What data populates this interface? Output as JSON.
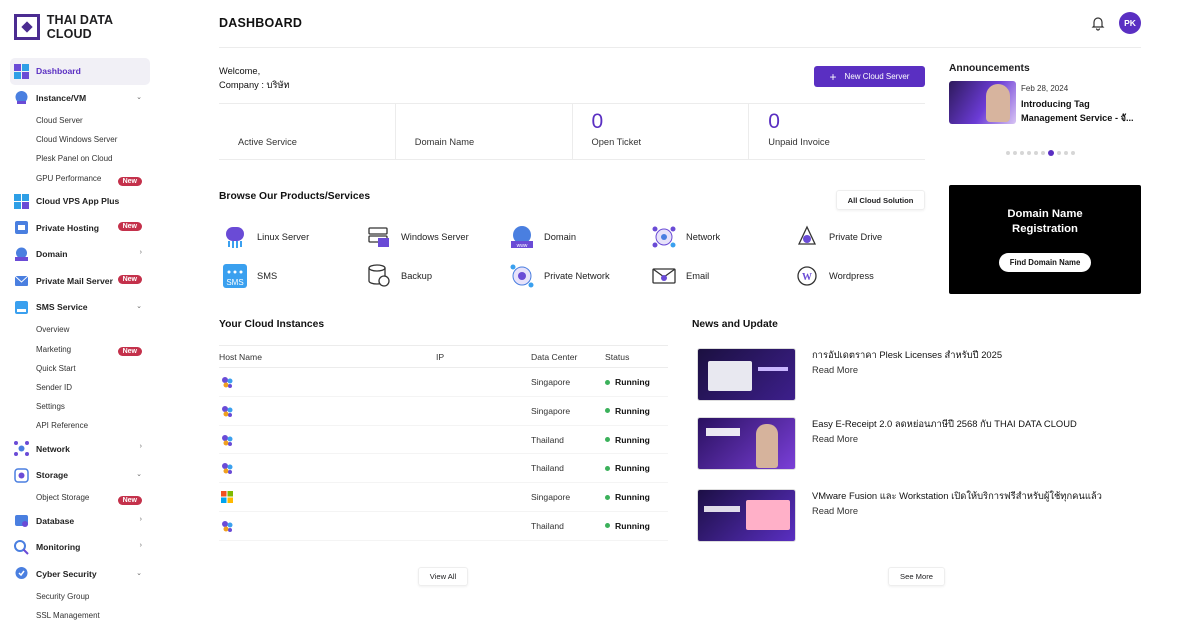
{
  "brand": {
    "name": "THAI DATA CLOUD"
  },
  "sidebar": {
    "items": [
      {
        "label": "Dashboard",
        "active": true,
        "chevron": "",
        "badge": ""
      },
      {
        "label": "Instance/VM",
        "chevron": "⌄",
        "badge": ""
      },
      {
        "label": "Cloud VPS App Plus",
        "chevron": "",
        "badge": ""
      },
      {
        "label": "Private Hosting",
        "chevron": "",
        "badge": "New"
      },
      {
        "label": "Domain",
        "chevron": "›",
        "badge": ""
      },
      {
        "label": "Private Mail Server",
        "chevron": "",
        "badge": "New"
      },
      {
        "label": "SMS Service",
        "chevron": "⌄",
        "badge": ""
      },
      {
        "label": "Network",
        "chevron": "›",
        "badge": ""
      },
      {
        "label": "Storage",
        "chevron": "⌄",
        "badge": ""
      },
      {
        "label": "Database",
        "chevron": "›",
        "badge": ""
      },
      {
        "label": "Monitoring",
        "chevron": "›",
        "badge": ""
      },
      {
        "label": "Cyber Security",
        "chevron": "⌄",
        "badge": ""
      }
    ],
    "instance_sub": [
      "Cloud Server",
      "Cloud Windows Server",
      "Plesk Panel on Cloud",
      "GPU Performance"
    ],
    "gpu_badge": "New",
    "sms_sub": [
      "Overview",
      "Marketing",
      "Quick Start",
      "Sender ID",
      "Settings",
      "API Reference"
    ],
    "marketing_badge": "New",
    "storage_sub": [
      "Object Storage"
    ],
    "object_storage_badge": "New",
    "security_sub": [
      "Security Group",
      "SSL Management"
    ]
  },
  "header": {
    "title": "DASHBOARD",
    "avatar_initials": "PK",
    "bell_icon": "bell-icon"
  },
  "welcome": {
    "greeting": "Welcome,",
    "company": "Company : บริษัท",
    "new_server_label": "New Cloud Server"
  },
  "stats": [
    {
      "value": "",
      "label": "Active Service"
    },
    {
      "value": "",
      "label": "Domain Name"
    },
    {
      "value": "0",
      "label": "Open Ticket"
    },
    {
      "value": "0",
      "label": "Unpaid Invoice"
    }
  ],
  "products": {
    "title": "Browse Our Products/Services",
    "all_button": "All Cloud Solution",
    "items": [
      {
        "label": "Linux Server",
        "icon": "linux-server-icon"
      },
      {
        "label": "Windows Server",
        "icon": "windows-server-icon"
      },
      {
        "label": "Domain",
        "icon": "domain-icon"
      },
      {
        "label": "Network",
        "icon": "network-icon"
      },
      {
        "label": "Private Drive",
        "icon": "private-drive-icon"
      },
      {
        "label": "SMS",
        "icon": "sms-icon"
      },
      {
        "label": "Backup",
        "icon": "backup-icon"
      },
      {
        "label": "Private Network",
        "icon": "private-network-icon"
      },
      {
        "label": "Email",
        "icon": "email-icon"
      },
      {
        "label": "Wordpress",
        "icon": "wordpress-icon"
      }
    ]
  },
  "announcements": {
    "title": "Announcements",
    "date": "Feb 28, 2024",
    "text": "Introducing Tag Management Service - จั...",
    "slide_count": 10,
    "active_slide": 6
  },
  "domain_card": {
    "title_line1": "Domain Name",
    "title_line2": "Registration",
    "button": "Find Domain Name"
  },
  "instances": {
    "title": "Your Cloud Instances",
    "columns": [
      "Host Name",
      "IP",
      "Data Center",
      "Status"
    ],
    "rows": [
      {
        "host": "",
        "ip": "",
        "dc": "Singapore",
        "status": "Running",
        "os_icon": "linux-os-icon"
      },
      {
        "host": "",
        "ip": "",
        "dc": "Singapore",
        "status": "Running",
        "os_icon": "linux-os-icon"
      },
      {
        "host": "",
        "ip": "",
        "dc": "Thailand",
        "status": "Running",
        "os_icon": "linux-os-icon"
      },
      {
        "host": "",
        "ip": "",
        "dc": "Thailand",
        "status": "Running",
        "os_icon": "linux-os-icon"
      },
      {
        "host": "",
        "ip": "",
        "dc": "Singapore",
        "status": "Running",
        "os_icon": "windows-os-icon"
      },
      {
        "host": "",
        "ip": "",
        "dc": "Thailand",
        "status": "Running",
        "os_icon": "linux-os-icon"
      }
    ],
    "view_all": "View All"
  },
  "news": {
    "title": "News and Update",
    "items": [
      {
        "title": "การอัปเดตราคา Plesk Licenses สำหรับปี 2025",
        "more": "Read More"
      },
      {
        "title": "Easy E-Receipt 2.0 ลดหย่อนภาษีปี 2568 กับ THAI DATA CLOUD",
        "more": "Read More"
      },
      {
        "title": "VMware Fusion และ Workstation เปิดให้บริการฟรีสำหรับผู้ใช้ทุกคนแล้ว",
        "more": "Read More"
      }
    ],
    "see_more": "See More"
  },
  "colors": {
    "accent": "#5a2fc2",
    "brand": "#4b2c91",
    "badge": "#c4314b",
    "status_running": "#3bb15b"
  }
}
